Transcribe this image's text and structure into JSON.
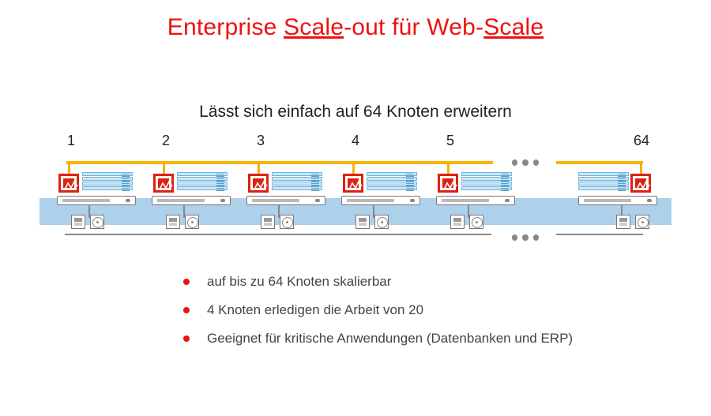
{
  "title": {
    "pre": "Enterprise ",
    "u1": "Scale",
    "mid": "-out für Web-",
    "u2": "Scale"
  },
  "subtitle": "Lässt sich einfach auf 64 Knoten erweitern",
  "nodes": {
    "labels": [
      "1",
      "2",
      "3",
      "4",
      "5",
      "64"
    ]
  },
  "bullets": [
    "auf bis zu 64 Knoten skalierbar",
    "4 Knoten erledigen die Arbeit von 20",
    "Geeignet für kritische Anwendungen (Datenbanken und ERP)"
  ],
  "colors": {
    "accent_red": "#e11",
    "network_yellow": "#f7b400",
    "band_blue": "#9fc8e8"
  }
}
